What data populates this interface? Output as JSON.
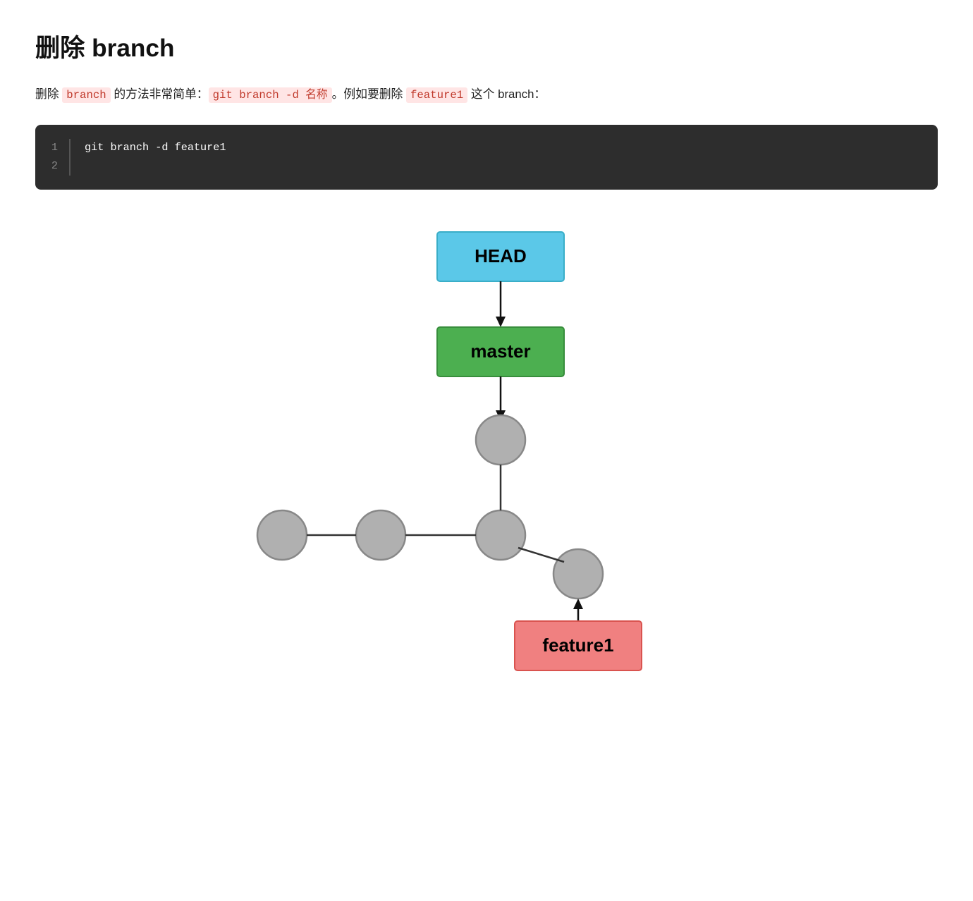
{
  "page": {
    "title": "删除 branch",
    "intro": {
      "prefix": "删除 ",
      "word_branch": "branch",
      "middle": " 的方法非常简单：",
      "command": "git branch -d 名称",
      "suffix": "。例如要删除 ",
      "feature_word": "feature1",
      "end": " 这个 branch："
    },
    "code_block": {
      "line1": "git branch -d feature1",
      "line2": "",
      "line_numbers": [
        "1",
        "2"
      ]
    },
    "diagram": {
      "head_label": "HEAD",
      "master_label": "master",
      "feature1_label": "feature1",
      "head_color": "#5bc8e8",
      "master_color": "#4caf50",
      "feature1_color": "#f08080",
      "node_color": "#b0b0b0",
      "node_stroke": "#888888"
    }
  }
}
